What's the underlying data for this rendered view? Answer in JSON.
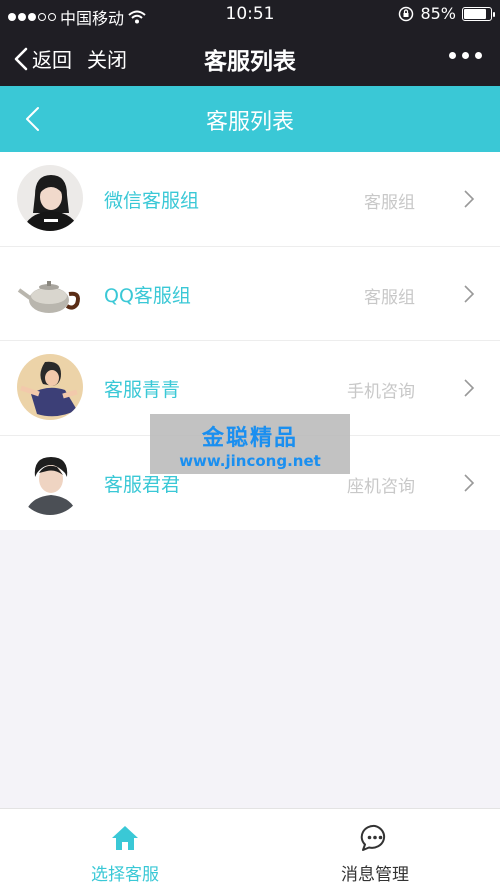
{
  "status_bar": {
    "carrier": "中国移动",
    "time": "10:51",
    "battery_percent": "85%",
    "battery_level": 0.85
  },
  "wechat_nav": {
    "back_label": "返回",
    "close_label": "关闭",
    "title": "客服列表"
  },
  "app_header": {
    "title": "客服列表"
  },
  "service_list": [
    {
      "name": "微信客服组",
      "tag": "客服组",
      "avatar": "girl-black-shirt"
    },
    {
      "name": "QQ客服组",
      "tag": "客服组",
      "avatar": "teapot"
    },
    {
      "name": "客服青青",
      "tag": "手机咨询",
      "avatar": "illustrated-girl"
    },
    {
      "name": "客服君君",
      "tag": "座机咨询",
      "avatar": "young-man"
    }
  ],
  "watermark": {
    "title": "金聪精品",
    "url": "www.jincong.net"
  },
  "tabbar": {
    "tabs": [
      {
        "label": "选择客服",
        "icon": "home-icon",
        "active": true
      },
      {
        "label": "消息管理",
        "icon": "chat-bubble-icon",
        "active": false
      }
    ]
  },
  "colors": {
    "accent": "#3ac8d6",
    "dark_bar": "#1f1e24",
    "tag_gray": "#c8c8c8"
  }
}
